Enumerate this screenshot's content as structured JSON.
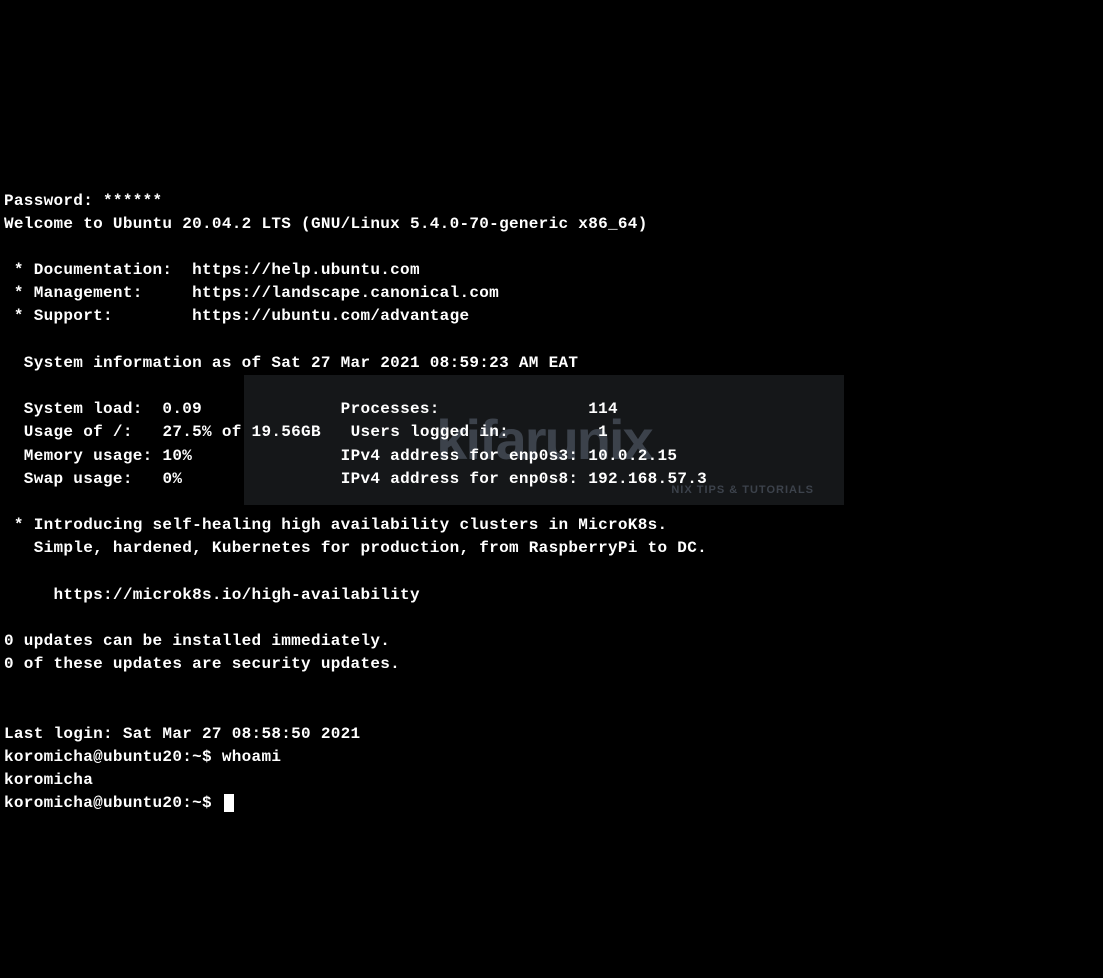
{
  "password_prompt": "Password: ******",
  "welcome": "Welcome to Ubuntu 20.04.2 LTS (GNU/Linux 5.4.0-70-generic x86_64)",
  "links": {
    "documentation": " * Documentation:  https://help.ubuntu.com",
    "management": " * Management:     https://landscape.canonical.com",
    "support": " * Support:        https://ubuntu.com/advantage"
  },
  "sysinfo_header": "  System information as of Sat 27 Mar 2021 08:59:23 AM EAT",
  "sysinfo": {
    "line1_left_label": "  System load:",
    "line1_left_value": "  0.09",
    "line1_right_label": "Processes:",
    "line1_right_value": "114",
    "line2_left_label": "  Usage of /:",
    "line2_left_value": "   27.5% of 19.56GB",
    "line2_right_label": "Users logged in:",
    "line2_right_value": "1",
    "line3_left_label": "  Memory usage:",
    "line3_left_value": " 10%",
    "line3_right_label": "IPv4 address for enp0s3:",
    "line3_right_value": "10.0.2.15",
    "line4_left_label": "  Swap usage:",
    "line4_left_value": "   0%",
    "line4_right_label": "IPv4 address for enp0s8:",
    "line4_right_value": "192.168.57.3"
  },
  "microk8s": {
    "line1": " * Introducing self-healing high availability clusters in MicroK8s.",
    "line2": "   Simple, hardened, Kubernetes for production, from RaspberryPi to DC.",
    "link": "     https://microk8s.io/high-availability"
  },
  "updates": {
    "line1": "0 updates can be installed immediately.",
    "line2": "0 of these updates are security updates."
  },
  "last_login": "Last login: Sat Mar 27 08:58:50 2021",
  "prompt1": {
    "prefix": "koromicha@ubuntu20:~$ ",
    "command": "whoami"
  },
  "whoami_output": "koromicha",
  "prompt2": {
    "prefix": "koromicha@ubuntu20:~$ "
  },
  "watermark": {
    "text": "kifarunix",
    "sub": "NIX TIPS & TUTORIALS"
  }
}
